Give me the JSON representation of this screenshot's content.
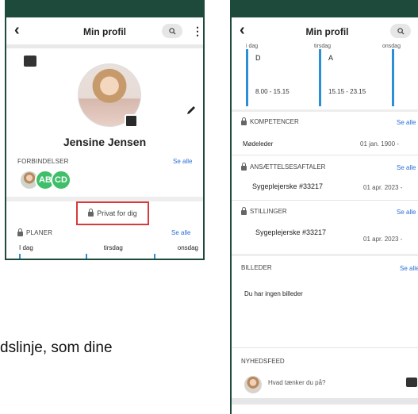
{
  "phone_a": {
    "title": "Min profil",
    "name": "Jensine Jensen",
    "connections_label": "FORBINDELSER",
    "connections_see_all": "Se alle",
    "connections": [
      "AB",
      "CD"
    ],
    "private_label": "Privat for dig",
    "plans_label": "PLANER",
    "plans_see_all": "Se alle",
    "days": [
      "I dag",
      "tirsdag",
      "onsdag"
    ]
  },
  "phone_b": {
    "title": "Min profil",
    "schedule_days": [
      "i dag",
      "tirsdag",
      "onsdag"
    ],
    "shifts": [
      {
        "letter": "D",
        "time": "8.00 - 15.15"
      },
      {
        "letter": "A",
        "time": "15.15 - 23.15"
      }
    ],
    "competences_label": "KOMPETENCER",
    "competences_see_all": "Se alle",
    "competence_item": "Mødeleder",
    "competence_date": "01 jan. 1900 -",
    "contracts_label": "ANSÆTTELSESAFTALER",
    "contracts_see_all": "Se alle",
    "contract_item": "Sygeplejerske #33217",
    "contract_date": "01 apr. 2023 -",
    "positions_label": "STILLINGER",
    "positions_see_all": "Se alle",
    "position_item": "Sygeplejerske #33217",
    "position_date": "01 apr. 2023 -",
    "images_label": "BILLEDER",
    "images_see_all": "Se alle",
    "images_empty": "Du har ingen billeder",
    "newsfeed_label": "NYHEDSFEED",
    "newsfeed_placeholder": "Hvad tænker du på?"
  },
  "caption": "dslinje, som dine",
  "colors": {
    "dark_green": "#1e4a3c",
    "link_blue": "#2a6fd6",
    "highlight_red": "#d83a3a",
    "avatar_green": "#3fbf6a",
    "shift_blue": "#2a8fd6"
  },
  "icons": [
    "back-arrow-icon",
    "search-icon",
    "more-vert-icon",
    "camera-icon",
    "pencil-icon",
    "lock-icon"
  ]
}
